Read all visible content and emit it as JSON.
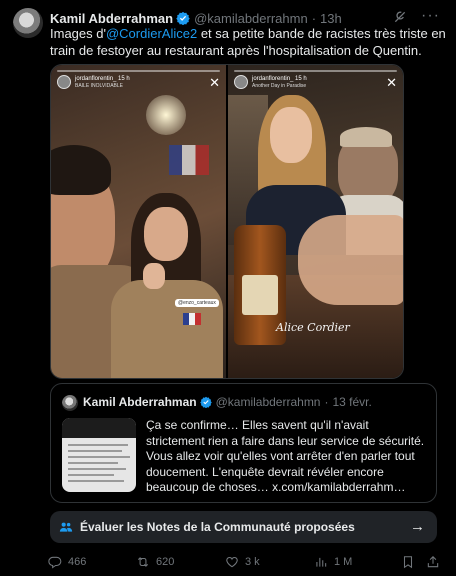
{
  "author": {
    "name": "Kamil Abderrahman",
    "handle": "@kamilabderrahmn",
    "time": "13h"
  },
  "tweet": {
    "text_before": "Images d'",
    "mention": "@CordierAlice2",
    "text_after": " et sa petite bande de racistes très triste en train de festoyer au restaurant après l'hospitalisation de Quentin."
  },
  "media": {
    "left": {
      "username": "jordanflorentin_",
      "time": "15 h",
      "subtitle": "BAILE INOLVIDABLE",
      "tag": "@enzo_carteaux"
    },
    "right": {
      "username": "jordanflorentin_",
      "time": "15 h",
      "subtitle": "Another Day in Paradise",
      "caption": "Alice Cordier"
    }
  },
  "quote": {
    "name": "Kamil Abderrahman",
    "handle": "@kamilabderrahmn",
    "date": "13 févr.",
    "text": "Ça se confirme… Elles savent qu'il n'avait strictement rien a faire dans leur service de sécurité. Vous allez voir qu'elles vont arrêter d'en parler tout doucement. L'enquête devrait révéler encore beaucoup de choses… x.com/kamilabderrahm…"
  },
  "community_notes": {
    "label": "Évaluer les Notes de la Communauté proposées"
  },
  "actions": {
    "replies": "466",
    "reposts": "620",
    "likes": "3 k",
    "views": "1 M"
  },
  "colors": {
    "background": "#000000",
    "accent": "#1d9bf0",
    "secondary_text": "#71767b",
    "verified": "#1d9bf0"
  }
}
